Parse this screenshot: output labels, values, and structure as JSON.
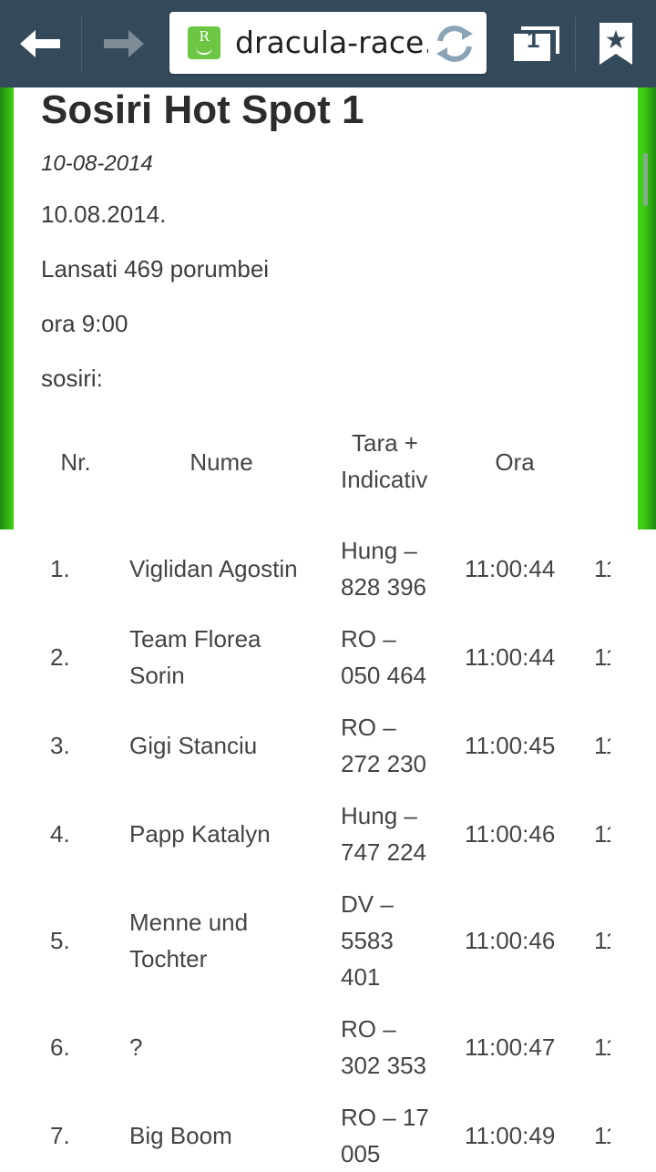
{
  "browser": {
    "url": "dracula-race.",
    "tab_count": "1"
  },
  "page": {
    "title": "Sosiri Hot Spot 1",
    "post_date": "10-08-2014",
    "date_line": "10.08.2014.",
    "launched": "Lansati 469 porumbei",
    "time": "ora 9:00",
    "arrivals_label": "sosiri:"
  },
  "table": {
    "headers": {
      "nr": "Nr.",
      "name": "Nume",
      "country_line1": "Tara +",
      "country_line2": "Indicativ",
      "time": "Ora"
    },
    "rows": [
      {
        "nr": "1.",
        "name1": "Viglidan Agostin",
        "name2": "",
        "ind1": "Hung –",
        "ind2": "828 396",
        "ind3": "",
        "time": "11:00:44",
        "cut": "11"
      },
      {
        "nr": "2.",
        "name1": "Team Florea",
        "name2": "Sorin",
        "ind1": "RO –",
        "ind2": "050 464",
        "ind3": "",
        "time": "11:00:44",
        "cut": "11"
      },
      {
        "nr": "3.",
        "name1": "Gigi Stanciu",
        "name2": "",
        "ind1": "RO –",
        "ind2": "272 230",
        "ind3": "",
        "time": "11:00:45",
        "cut": "11"
      },
      {
        "nr": "4.",
        "name1": "Papp Katalyn",
        "name2": "",
        "ind1": "Hung –",
        "ind2": "747 224",
        "ind3": "",
        "time": "11:00:46",
        "cut": "11"
      },
      {
        "nr": "5.",
        "name1": "Menne und",
        "name2": "Tochter",
        "ind1": "DV –",
        "ind2": "5583",
        "ind3": "401",
        "time": "11:00:46",
        "cut": "11"
      },
      {
        "nr": "6.",
        "name1": "?",
        "name2": "",
        "ind1": "RO –",
        "ind2": "302 353",
        "ind3": "",
        "time": "11:00:47",
        "cut": "11"
      },
      {
        "nr": "7.",
        "name1": "Big Boom",
        "name2": "",
        "ind1": "RO – 17",
        "ind2": "005",
        "ind3": "",
        "time": "11:00:49",
        "cut": "11"
      }
    ]
  }
}
